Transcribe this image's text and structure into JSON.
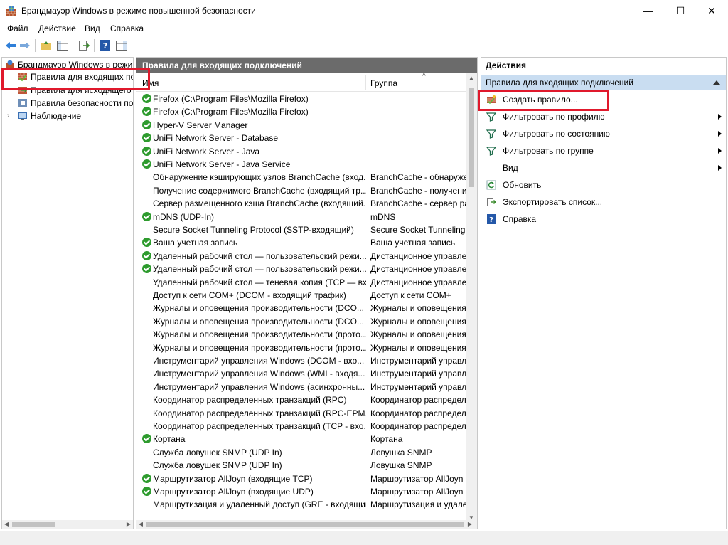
{
  "window": {
    "title": "Брандмауэр Windows в режиме повышенной безопасности",
    "minimize": "—",
    "maximize": "☐",
    "close": "✕"
  },
  "menu": [
    "Файл",
    "Действие",
    "Вид",
    "Справка"
  ],
  "tree": {
    "root": "Брандмауэр Windows в режиме повышенной безопасности",
    "items": [
      "Правила для входящих подключений",
      "Правила для исходящего подключения",
      "Правила безопасности подключения",
      "Наблюдение"
    ]
  },
  "center": {
    "header": "Правила для входящих подключений",
    "col_name": "Имя",
    "col_group": "Группа",
    "rows": [
      {
        "enabled": true,
        "name": "Firefox (C:\\Program Files\\Mozilla Firefox)",
        "group": ""
      },
      {
        "enabled": true,
        "name": "Firefox (C:\\Program Files\\Mozilla Firefox)",
        "group": ""
      },
      {
        "enabled": true,
        "name": "Hyper-V Server Manager",
        "group": ""
      },
      {
        "enabled": true,
        "name": "UniFi Network Server - Database",
        "group": ""
      },
      {
        "enabled": true,
        "name": "UniFi Network Server - Java",
        "group": ""
      },
      {
        "enabled": true,
        "name": "UniFi Network Server - Java Service",
        "group": ""
      },
      {
        "enabled": false,
        "name": "Обнаружение кэширующих узлов BranchCache (вход...",
        "group": "BranchCache - обнаружени"
      },
      {
        "enabled": false,
        "name": "Получение содержимого BranchCache (входящий тр...",
        "group": "BranchCache - получение"
      },
      {
        "enabled": false,
        "name": "Сервер размещенного кэша BranchCache (входящий...",
        "group": "BranchCache - сервер разм"
      },
      {
        "enabled": true,
        "name": "mDNS (UDP-In)",
        "group": "mDNS"
      },
      {
        "enabled": false,
        "name": "Secure Socket Tunneling Protocol (SSTP-входящий)",
        "group": "Secure Socket Tunneling P"
      },
      {
        "enabled": true,
        "name": "Ваша учетная запись",
        "group": "Ваша учетная запись"
      },
      {
        "enabled": true,
        "name": "Удаленный рабочий стол — пользовательский режи...",
        "group": "Дистанционное управлен"
      },
      {
        "enabled": true,
        "name": "Удаленный рабочий стол — пользовательский режи...",
        "group": "Дистанционное управлен"
      },
      {
        "enabled": false,
        "name": "Удаленный рабочий стол — теневая копия (TCP — вх...",
        "group": "Дистанционное управлен"
      },
      {
        "enabled": false,
        "name": "Доступ к сети COM+ (DCOM - входящий трафик)",
        "group": "Доступ к сети COM+"
      },
      {
        "enabled": false,
        "name": "Журналы и оповещения производительности (DCO...",
        "group": "Журналы и оповещения п"
      },
      {
        "enabled": false,
        "name": "Журналы и оповещения производительности (DCO...",
        "group": "Журналы и оповещения п"
      },
      {
        "enabled": false,
        "name": "Журналы и оповещения производительности (прото...",
        "group": "Журналы и оповещения п"
      },
      {
        "enabled": false,
        "name": "Журналы и оповещения производительности (прото...",
        "group": "Журналы и оповещения п"
      },
      {
        "enabled": false,
        "name": "Инструментарий управления Windows (DCOM - вхо...",
        "group": "Инструментарий управле"
      },
      {
        "enabled": false,
        "name": "Инструментарий управления Windows (WMI - входя...",
        "group": "Инструментарий управле"
      },
      {
        "enabled": false,
        "name": "Инструментарий управления Windows (асинхронны...",
        "group": "Инструментарий управле"
      },
      {
        "enabled": false,
        "name": "Координатор распределенных транзакций (RPC)",
        "group": "Координатор распределен"
      },
      {
        "enabled": false,
        "name": "Координатор распределенных транзакций (RPC-EPM...",
        "group": "Координатор распределен"
      },
      {
        "enabled": false,
        "name": "Координатор распределенных транзакций (TCP - вхо...",
        "group": "Координатор распределен"
      },
      {
        "enabled": true,
        "name": "Кортана",
        "group": "Кортана"
      },
      {
        "enabled": false,
        "name": "Служба ловушек SNMP (UDP In)",
        "group": "Ловушка SNMP"
      },
      {
        "enabled": false,
        "name": "Служба ловушек SNMP (UDP In)",
        "group": "Ловушка SNMP"
      },
      {
        "enabled": true,
        "name": "Маршрутизатор AllJoyn (входящие TCP)",
        "group": "Маршрутизатор AllJoyn"
      },
      {
        "enabled": true,
        "name": "Маршрутизатор AllJoyn (входящие UDP)",
        "group": "Маршрутизатор AllJoyn"
      },
      {
        "enabled": false,
        "name": "Маршрутизация и удаленный доступ (GRE - входящий)",
        "group": "Маршрутизация и удален"
      }
    ]
  },
  "actions": {
    "title": "Действия",
    "section": "Правила для входящих подключений",
    "items": [
      {
        "label": "Создать правило...",
        "icon": "new-rule-icon",
        "submenu": false
      },
      {
        "label": "Фильтровать по профилю",
        "icon": "filter-icon",
        "submenu": true
      },
      {
        "label": "Фильтровать по состоянию",
        "icon": "filter-icon",
        "submenu": true
      },
      {
        "label": "Фильтровать по группе",
        "icon": "filter-icon",
        "submenu": true
      },
      {
        "label": "Вид",
        "icon": "",
        "submenu": true
      },
      {
        "label": "Обновить",
        "icon": "refresh-icon",
        "submenu": false
      },
      {
        "label": "Экспортировать список...",
        "icon": "export-icon",
        "submenu": false
      },
      {
        "label": "Справка",
        "icon": "help-icon",
        "submenu": false
      }
    ]
  },
  "colors": {
    "highlight_box": "#e0192c",
    "enabled_check": "#2e9b2e",
    "pane_header": "#6b6b6b",
    "actions_section": "#c9ddf1"
  }
}
